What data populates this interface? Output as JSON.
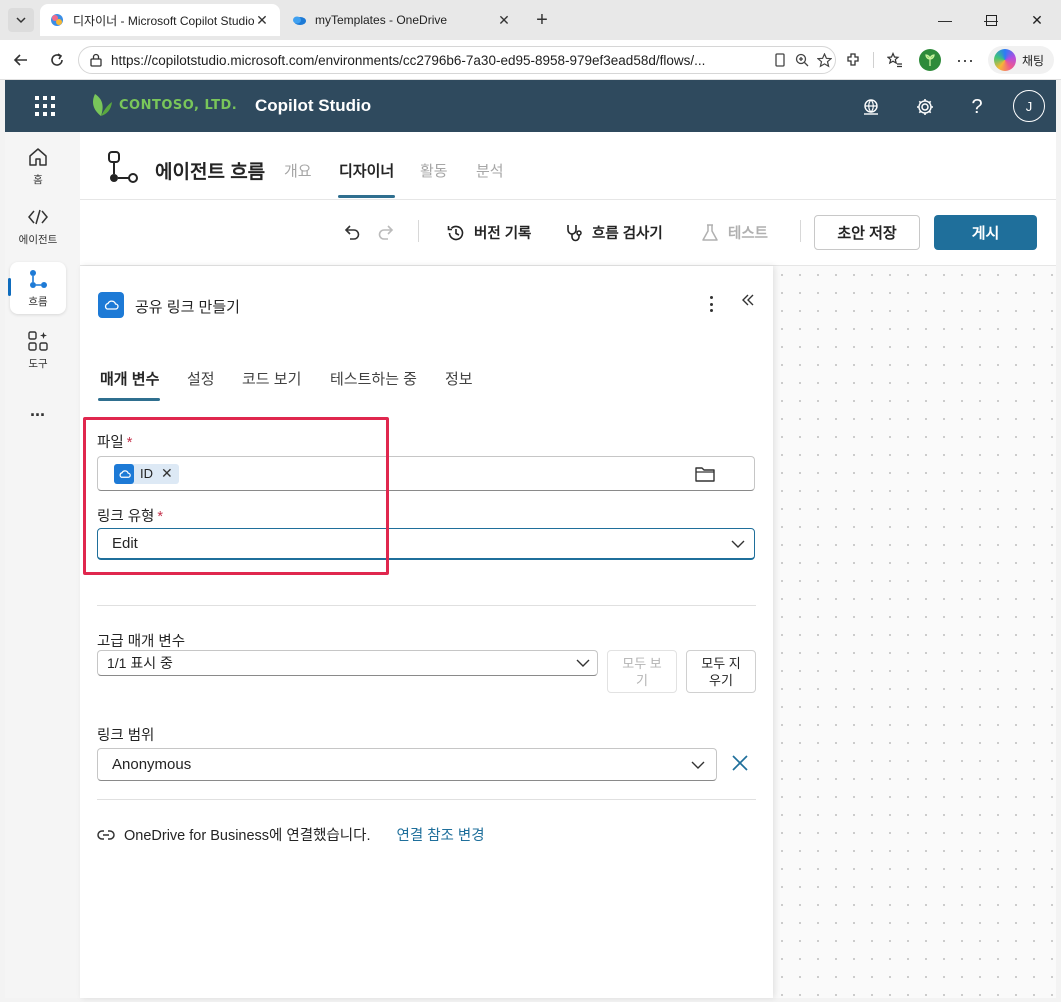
{
  "browser": {
    "tabs": [
      {
        "title": "디자이너 - Microsoft Copilot Studio",
        "active": true
      },
      {
        "title": "myTemplates - OneDrive",
        "active": false
      }
    ],
    "url": "https://copilotstudio.microsoft.com/environments/cc2796b6-7a30-ed95-8958-979ef3ead58d/flows/...",
    "chat_label": "채팅"
  },
  "header": {
    "brand": "CONTOSO, LTD.",
    "app_name": "Copilot Studio",
    "avatar_initial": "J",
    "icons": [
      "environment-icon",
      "settings-icon",
      "help-icon"
    ]
  },
  "rail": {
    "items": [
      {
        "label": "홈",
        "icon": "home-icon"
      },
      {
        "label": "에이전트",
        "icon": "code-icon"
      },
      {
        "label": "흐름",
        "icon": "flow-icon",
        "active": true
      },
      {
        "label": "도구",
        "icon": "tools-icon"
      }
    ],
    "more": "..."
  },
  "page": {
    "title": "에이전트 흐름",
    "tabs": [
      {
        "label": "개요",
        "state": "disabled"
      },
      {
        "label": "디자이너",
        "state": "active"
      },
      {
        "label": "활동",
        "state": "disabled"
      },
      {
        "label": "분석",
        "state": "disabled"
      }
    ]
  },
  "toolbar": {
    "version_history": "버전 기록",
    "flow_checker": "흐름 검사기",
    "test": "테스트",
    "save_draft": "초안 저장",
    "publish": "게시"
  },
  "panel": {
    "title": "공유 링크 만들기",
    "tabs": [
      {
        "label": "매개 변수",
        "active": true
      },
      {
        "label": "설정"
      },
      {
        "label": "코드 보기"
      },
      {
        "label": "테스트하는 중"
      },
      {
        "label": "정보"
      }
    ],
    "file": {
      "label": "파일",
      "required_mark": "*",
      "chip": "ID"
    },
    "link_type": {
      "label": "링크 유형",
      "required_mark": "*",
      "value": "Edit"
    },
    "advanced": {
      "label": "고급 매개 변수",
      "value": "1/1 표시 중",
      "show_all": "모두 보기",
      "clear_all": "모두 지우기"
    },
    "link_scope": {
      "label": "링크 범위",
      "value": "Anonymous"
    },
    "connection": {
      "text": "OneDrive for Business에 연결했습니다.",
      "link": "연결 참조 변경"
    }
  },
  "colors": {
    "header_bg": "#2f4a5e",
    "accent": "#1f6f9b",
    "highlight": "#e0274e",
    "brand_green": "#79c65a"
  }
}
